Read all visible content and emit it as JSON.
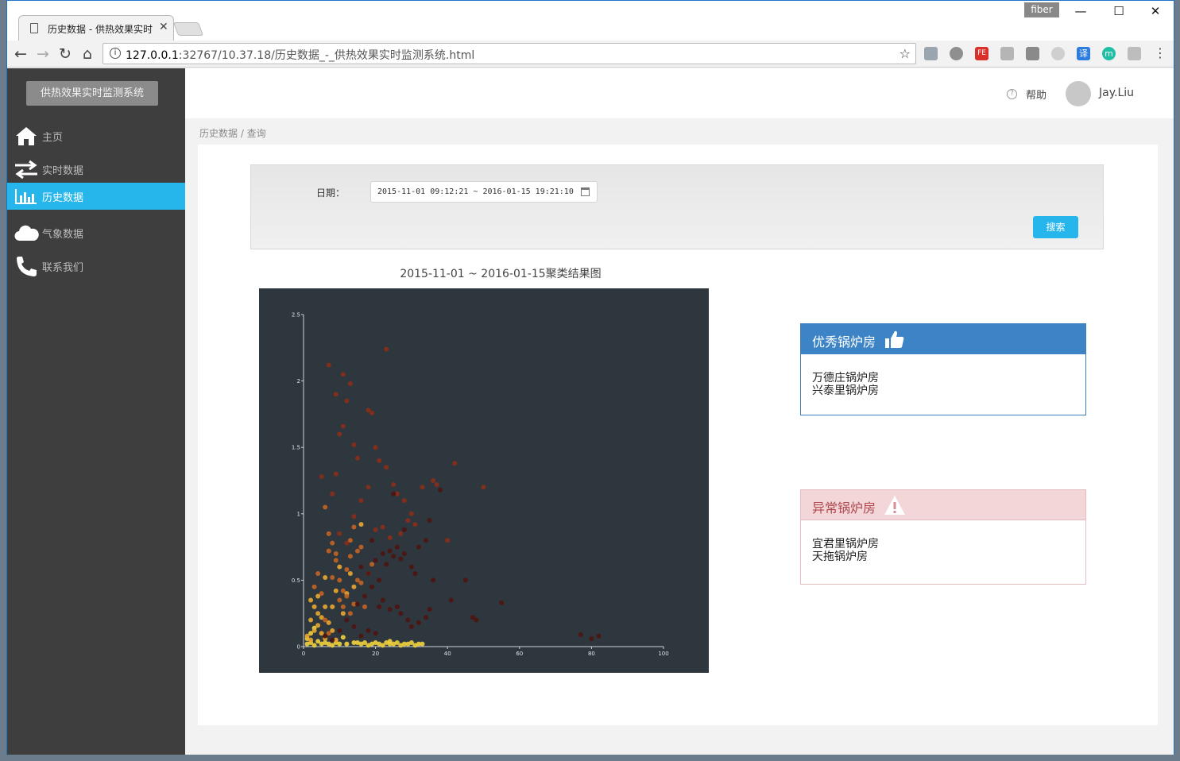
{
  "browser": {
    "tab_title": "历史数据 - 供热效果实时",
    "url_host": "127.0.0.1",
    "url_path": ":32767/10.37.18/历史数据_-_供热效果实时监测系统.html",
    "user_chip": "fiber",
    "ext_translate": "译",
    "ext_m": "m",
    "ext_fe": "FE"
  },
  "sidebar": {
    "brand": "供热效果实时监测系统",
    "items": [
      {
        "label": "主页",
        "icon": "home-icon"
      },
      {
        "label": "实时数据",
        "icon": "transfer-arrows-icon"
      },
      {
        "label": "历史数据",
        "icon": "bar-chart-icon",
        "active": true
      },
      {
        "label": "气象数据",
        "icon": "cloud-icon"
      },
      {
        "label": "联系我们",
        "icon": "phone-icon"
      }
    ]
  },
  "header": {
    "help": "帮助",
    "user": "Jay.Liu"
  },
  "breadcrumb": "历史数据 / 查询",
  "search": {
    "date_label": "日期：",
    "date_range": "2015-11-01 09:12:21 ~ 2016-01-15 19:21:10",
    "button": "搜索"
  },
  "chart_data": {
    "type": "scatter",
    "title": "2015-11-01 ~ 2016-01-15聚类结果图",
    "xlabel": "",
    "ylabel": "",
    "xlim": [
      0,
      100
    ],
    "ylim": [
      0,
      2.5
    ],
    "x_ticks": [
      "0",
      "20",
      "40",
      "60",
      "80",
      "100"
    ],
    "y_ticks": [
      "0",
      "0.5",
      "1",
      "1.5",
      "2",
      "2.5"
    ],
    "background": "#2e363e",
    "series": [
      {
        "color": "#f0d23c",
        "points": [
          [
            1,
            0.02
          ],
          [
            2,
            0.03
          ],
          [
            3,
            0.01
          ],
          [
            4,
            0.04
          ],
          [
            5,
            0.02
          ],
          [
            6,
            0.03
          ],
          [
            7,
            0.02
          ],
          [
            8,
            0.01
          ],
          [
            9,
            0.03
          ],
          [
            10,
            0.02
          ],
          [
            12,
            0.02
          ],
          [
            14,
            0.03
          ],
          [
            16,
            0.02
          ],
          [
            17,
            0.03
          ],
          [
            18,
            0.01
          ],
          [
            19,
            0.02
          ],
          [
            20,
            0.03
          ],
          [
            21,
            0.02
          ],
          [
            22,
            0.01
          ],
          [
            23,
            0.03
          ],
          [
            24,
            0.02
          ],
          [
            25,
            0.02
          ],
          [
            26,
            0.03
          ],
          [
            27,
            0.01
          ],
          [
            28,
            0.02
          ],
          [
            29,
            0.02
          ],
          [
            30,
            0.03
          ],
          [
            31,
            0.01
          ],
          [
            32,
            0.02
          ],
          [
            33,
            0.02
          ],
          [
            15,
            0.03
          ],
          [
            24,
            0.04
          ],
          [
            11,
            0.07
          ],
          [
            2,
            0.1
          ],
          [
            3,
            0.14
          ],
          [
            1,
            0.06
          ]
        ]
      },
      {
        "color": "#e8a830",
        "points": [
          [
            1,
            0.08
          ],
          [
            2,
            0.05
          ],
          [
            3,
            0.12
          ],
          [
            4,
            0.16
          ],
          [
            2,
            0.2
          ],
          [
            5,
            0.1
          ],
          [
            3,
            0.3
          ],
          [
            6,
            0.06
          ],
          [
            4,
            0.25
          ],
          [
            7,
            0.18
          ],
          [
            8,
            0.12
          ],
          [
            5,
            0.22
          ],
          [
            6,
            0.3
          ],
          [
            9,
            0.05
          ],
          [
            2,
            0.35
          ],
          [
            4,
            0.38
          ],
          [
            12,
            0.4
          ],
          [
            10,
            0.6
          ],
          [
            11,
            0.25
          ],
          [
            14,
            0.45
          ],
          [
            6,
            0.52
          ],
          [
            8,
            0.3
          ],
          [
            13,
            0.55
          ],
          [
            9,
            0.42
          ],
          [
            16,
            0.92
          ]
        ]
      },
      {
        "color": "#c46424",
        "points": [
          [
            5,
            0.4
          ],
          [
            6,
            0.2
          ],
          [
            8,
            0.52
          ],
          [
            7,
            0.72
          ],
          [
            9,
            0.65
          ],
          [
            10,
            0.5
          ],
          [
            11,
            0.42
          ],
          [
            12,
            0.58
          ],
          [
            13,
            0.68
          ],
          [
            14,
            0.32
          ],
          [
            15,
            0.5
          ],
          [
            6,
            1.05
          ],
          [
            7,
            0.85
          ],
          [
            8,
            0.78
          ],
          [
            9,
            0.7
          ],
          [
            12,
            0.38
          ],
          [
            13,
            0.25
          ],
          [
            15,
            0.72
          ],
          [
            18,
            0.55
          ],
          [
            11,
            0.3
          ],
          [
            10,
            0.35
          ],
          [
            4,
            0.55
          ],
          [
            3,
            0.45
          ],
          [
            7,
            0.1
          ],
          [
            14,
            0.9
          ],
          [
            16,
            0.75
          ],
          [
            19,
            0.62
          ],
          [
            13,
            0.8
          ],
          [
            16,
            0.48
          ],
          [
            17,
            0.3
          ]
        ]
      },
      {
        "color": "#8c2e1a",
        "points": [
          [
            5,
            1.28
          ],
          [
            8,
            1.15
          ],
          [
            9,
            1.3
          ],
          [
            10,
            1.6
          ],
          [
            11,
            1.66
          ],
          [
            12,
            1.85
          ],
          [
            14,
            1.52
          ],
          [
            15,
            1.42
          ],
          [
            18,
            1.78
          ],
          [
            19,
            1.76
          ],
          [
            20,
            1.5
          ],
          [
            21,
            1.4
          ],
          [
            23,
            1.35
          ],
          [
            25,
            1.22
          ],
          [
            26,
            1.15
          ],
          [
            28,
            1.1
          ],
          [
            30,
            1.0
          ],
          [
            33,
            1.2
          ],
          [
            36,
            1.25
          ],
          [
            37,
            1.22
          ],
          [
            42,
            1.38
          ],
          [
            50,
            1.2
          ],
          [
            18,
            1.2
          ],
          [
            16,
            1.1
          ],
          [
            14,
            0.98
          ],
          [
            20,
            0.88
          ],
          [
            22,
            0.9
          ],
          [
            24,
            0.82
          ],
          [
            27,
            0.85
          ],
          [
            29,
            0.95
          ],
          [
            31,
            0.92
          ],
          [
            12,
            0.78
          ],
          [
            10,
            0.85
          ],
          [
            40,
            0.8
          ],
          [
            7,
            2.12
          ],
          [
            11,
            2.05
          ],
          [
            23,
            2.24
          ],
          [
            13,
            1.98
          ],
          [
            9,
            1.9
          ]
        ]
      },
      {
        "color": "#4e1410",
        "points": [
          [
            16,
            0.6
          ],
          [
            18,
            0.55
          ],
          [
            20,
            0.65
          ],
          [
            22,
            0.7
          ],
          [
            24,
            0.72
          ],
          [
            25,
            0.68
          ],
          [
            26,
            0.75
          ],
          [
            27,
            0.66
          ],
          [
            28,
            0.7
          ],
          [
            23,
            0.62
          ],
          [
            21,
            0.5
          ],
          [
            19,
            0.45
          ],
          [
            17,
            0.38
          ],
          [
            15,
            0.32
          ],
          [
            22,
            0.35
          ],
          [
            24,
            0.28
          ],
          [
            26,
            0.3
          ],
          [
            27,
            0.25
          ],
          [
            29,
            0.2
          ],
          [
            30,
            0.15
          ],
          [
            32,
            0.18
          ],
          [
            34,
            0.22
          ],
          [
            35,
            0.28
          ],
          [
            36,
            0.5
          ],
          [
            41,
            0.35
          ],
          [
            45,
            0.5
          ],
          [
            47,
            0.22
          ],
          [
            48,
            0.2
          ],
          [
            55,
            0.33
          ],
          [
            77,
            0.09
          ],
          [
            80,
            0.06
          ],
          [
            82,
            0.08
          ],
          [
            12,
            0.2
          ],
          [
            14,
            0.15
          ],
          [
            16,
            0.08
          ],
          [
            18,
            0.12
          ],
          [
            20,
            0.1
          ],
          [
            10,
            0.12
          ],
          [
            8,
            0.05
          ],
          [
            6,
            0.08
          ],
          [
            30,
            0.6
          ],
          [
            32,
            0.75
          ],
          [
            34,
            0.8
          ],
          [
            35,
            0.95
          ],
          [
            38,
            1.18
          ],
          [
            25,
            1.15
          ],
          [
            28,
            0.88
          ],
          [
            31,
            0.55
          ],
          [
            19,
            0.8
          ],
          [
            21,
            0.3
          ]
        ]
      }
    ]
  },
  "good_card": {
    "title": "优秀锅炉房",
    "items": [
      "万德庄锅炉房",
      "兴泰里锅炉房"
    ]
  },
  "bad_card": {
    "title": "异常锅炉房",
    "items": [
      "宜君里锅炉房",
      "天拖锅炉房"
    ]
  }
}
